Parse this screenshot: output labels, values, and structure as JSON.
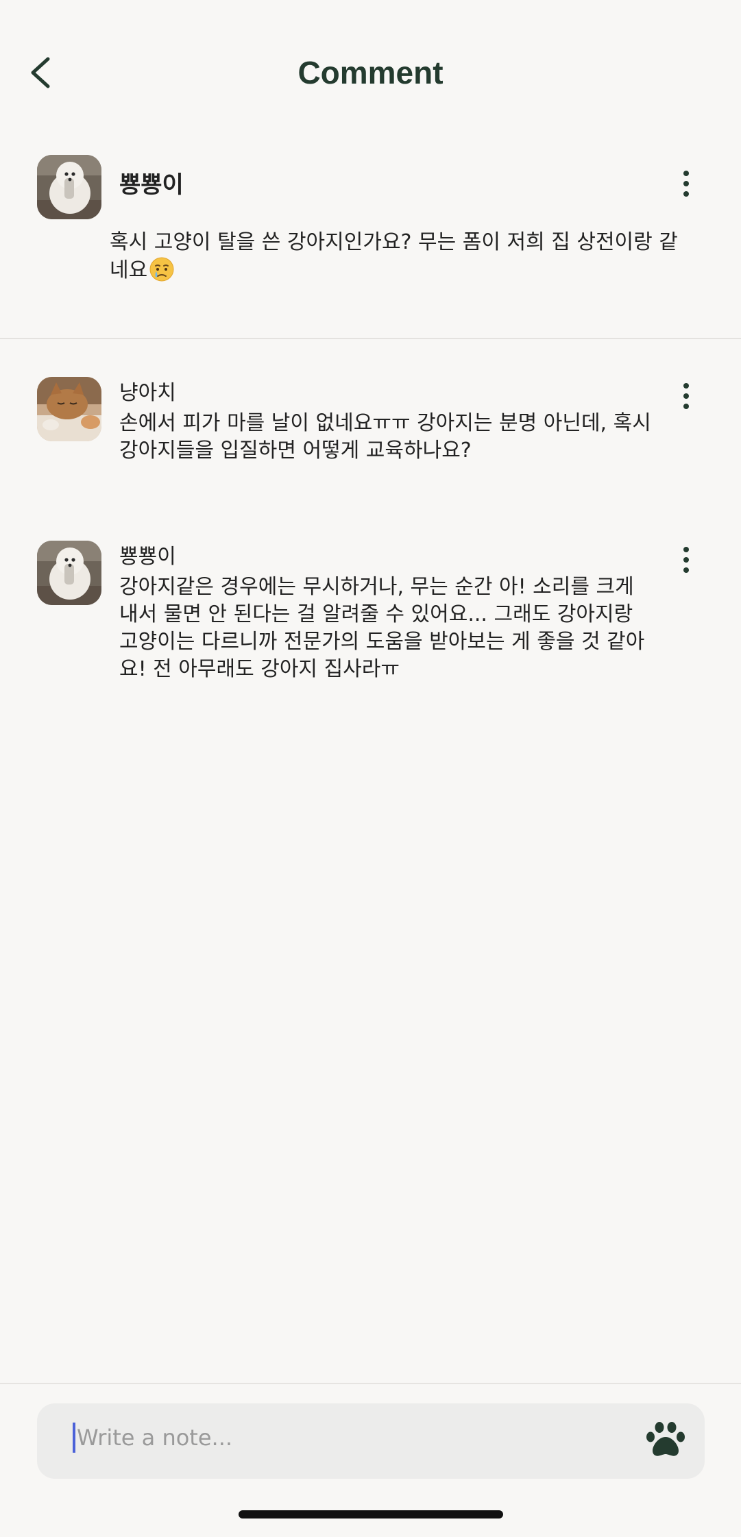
{
  "header": {
    "title": "Comment"
  },
  "post": {
    "author": "뿅뿅이",
    "body": "혹시 고양이 탈을 쓴 강아지인가요? 무는 폼이 저희 집 상전이랑 같네요"
  },
  "comments": [
    {
      "author": "냥아치",
      "text": "손에서 피가 마를 날이 없네요ㅠㅠ 강아지는 분명 아닌데, 혹시 강아지들을 입질하면 어떻게 교육하나요?"
    },
    {
      "author": "뿅뿅이",
      "text": "강아지같은 경우에는 무시하거나, 무는 순간 아! 소리를 크게 내서 물면 안 된다는 걸 알려줄 수 있어요... 그래도 강아지랑 고양이는 다르니까 전문가의 도움을 받아보는 게 좋을 것 같아요! 전 아무래도 강아지 집사라ㅠ"
    }
  ],
  "composer": {
    "placeholder": "Write a note...",
    "value": ""
  },
  "icons": {
    "back": "chevron-left-icon",
    "more": "more-vertical-icon",
    "emoji": "crying-face-emoji",
    "send": "paw-icon"
  },
  "colors": {
    "background": "#f8f7f5",
    "title": "#243b2f",
    "accent": "#243b2f",
    "input_background": "#ececeb",
    "caret": "#4b61d8"
  }
}
